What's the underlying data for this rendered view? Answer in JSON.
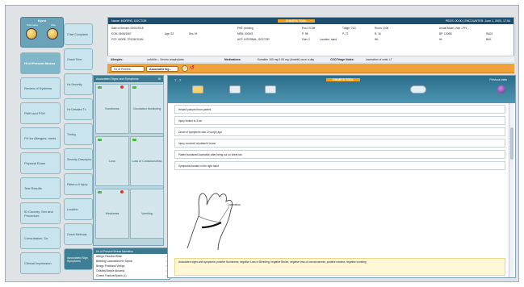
{
  "user": {
    "title": "Kyrsl",
    "role_left": "Sharmaine",
    "role_right": "Rita"
  },
  "nav": [
    "H/ of Present Illness",
    "Review of Systems",
    "PMH and PSH",
    "FH for Allergies, meds",
    "Physical Exam",
    "Test Results",
    "ID Country, Sex and Procedure",
    "Consultation, Dx",
    "Clinical Impression",
    "Disposition",
    "Instructions"
  ],
  "subnav": [
    "Chief Complaint",
    "Onset Time",
    "Hx Severity",
    "Hx Detailed Tx",
    "Timing",
    "Severity Descriptor",
    "Pattern of Injury",
    "Location",
    "Onset Methods",
    "Quantity",
    "Associated Sign Symptoms",
    "Additional Observations"
  ],
  "header": {
    "left": "Name: MORRIS, DOCTOR",
    "center": "CHARTS TOOL",
    "right": "PEDS: 00:00 | ENCOUNTER: June 1, 2020, 17:54",
    "r1": [
      "Date of Service: 04/01/2018",
      "PHE: pending",
      "Prov: ECIM",
      "Triage: 0:01",
      "Room: Q:06",
      "Arrival Mode: Vwb – Prv"
    ],
    "r2": [
      "DOB: 05/05/1967",
      "Age: 52",
      "Sex: M",
      "MRN: 000001",
      "P: 98",
      "P: 72",
      "R: 16",
      "BP: 120/80",
      "SaO2"
    ],
    "r3": [
      "PCP: MORE, TRICIDOCAN",
      "ACP: INTERNAL, DOCTOR",
      "Pain: 2",
      "Location: hand",
      "Wt: ",
      "Ht: ",
      "BMI: "
    ]
  },
  "allergy": {
    "label": "Allergies:",
    "value": "pcNcIlin – Severe anaphylaxis",
    "med_label": "Medications:",
    "meds": "Sumatrin 100 mg 0.05 mg (Unable) once a day",
    "ref_label": "CSC/Triage Notes:",
    "ref": "Laceration of wrist, LT"
  },
  "toolbar": {
    "dropdown": "Hx of Present...",
    "field": "Associated Sig..."
  },
  "signs": {
    "title": "Associated Signs and Symptoms",
    "cells": [
      "Numbness",
      "Circulation Monitoring",
      "Loss",
      "Loss of Consciousness",
      "Weakness",
      "Vomiting"
    ]
  },
  "review": {
    "title": "Hx of Present Illness Narrative",
    "items": [
      "Allergic Reaction/Rash",
      "Bleeding Lacerations/Hx Sepsis",
      "Benign Positional Vertigo",
      "Cellulitis/Simple Abscess",
      "Closed Fracture/Sprain (L)"
    ]
  },
  "main": {
    "label": "T - T",
    "tag": "CHARTS TOOL",
    "stamp": "Previous visits",
    "lines": [
      "Helped pumped from patient",
      "Injury limited to 3 cm",
      "Onset of symptoms was 2 hour(s) ago",
      "Injury occurred at patient's home",
      "Patient sustained laceration after being cut on sheet rail",
      "Symptoms located in the right hand"
    ],
    "figure_label": "Laceration",
    "note": "Associated signs and symptoms: positive Numbness; negative Loss of Bleeding, negative Bruise, negative loss of consciousness, positive nausea, negative vomiting"
  }
}
